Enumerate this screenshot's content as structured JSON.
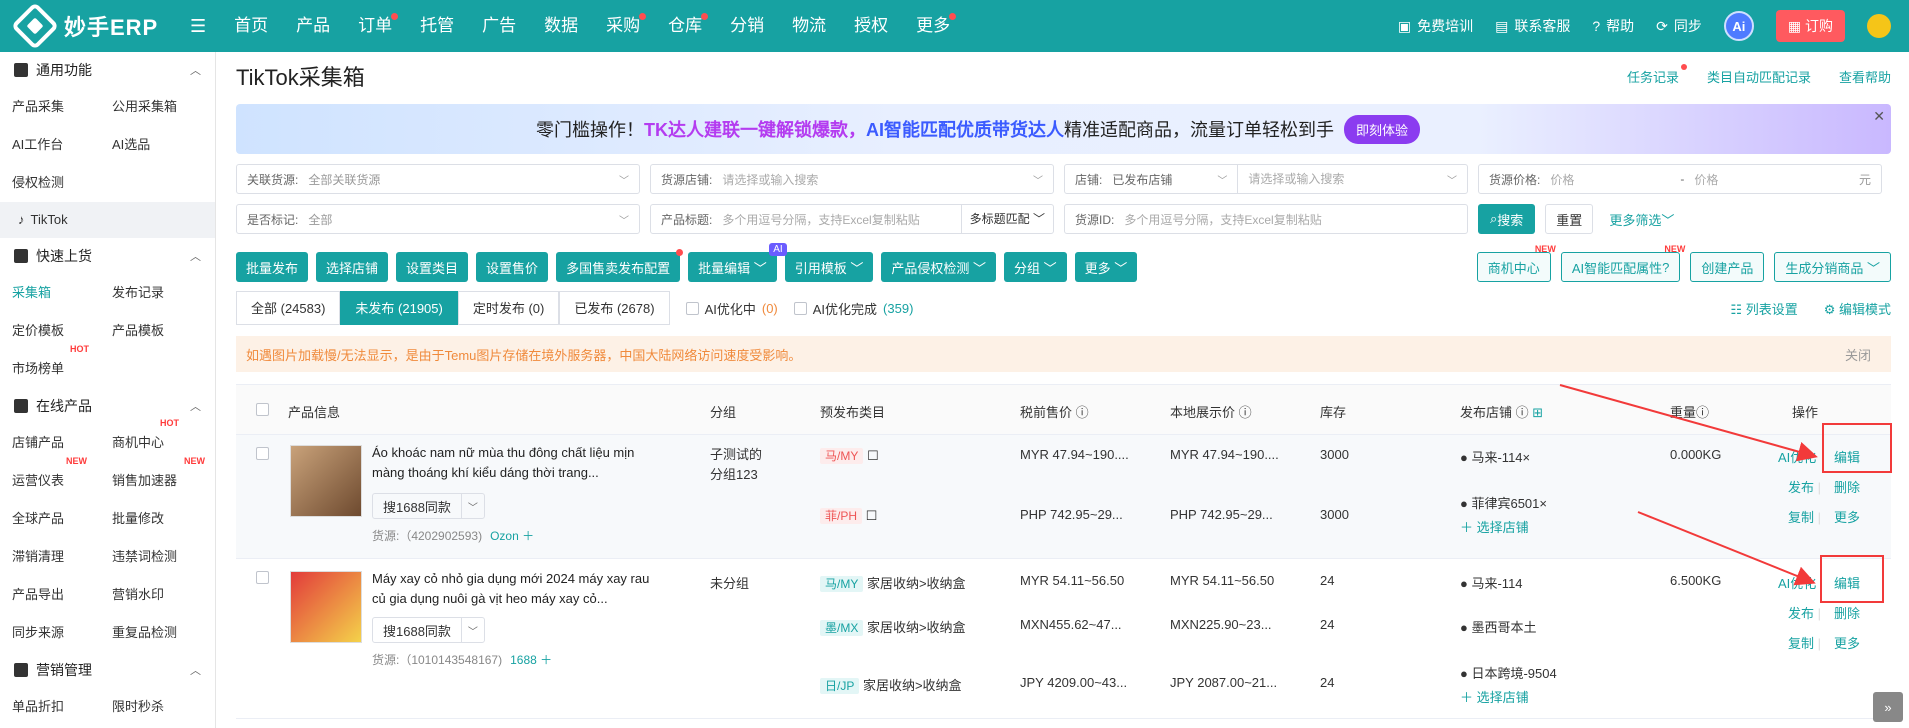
{
  "topbar": {
    "brand": "妙手ERP",
    "nav": [
      "首页",
      "产品",
      "订单",
      "托管",
      "广告",
      "数据",
      "采购",
      "仓库",
      "分销",
      "物流",
      "授权",
      "更多"
    ],
    "nav_dots": [
      false,
      false,
      true,
      false,
      false,
      false,
      true,
      true,
      false,
      false,
      false,
      true
    ],
    "right": {
      "training": "免费培训",
      "support": "联系客服",
      "help": "帮助",
      "sync": "同步",
      "ai": "Ai",
      "order": "订购"
    }
  },
  "sidebar": {
    "sec1": {
      "title": "通用功能",
      "items": [
        "产品采集",
        "公用采集箱",
        "AI工作台",
        "AI选品",
        "侵权检测"
      ]
    },
    "tiktok": "TikTok",
    "sec2": {
      "title": "快速上货",
      "items": [
        "采集箱",
        "发布记录",
        "定价模板",
        "产品模板",
        "市场榜单"
      ],
      "hot": "HOT"
    },
    "sec3": {
      "title": "在线产品",
      "items": [
        "店铺产品",
        "商机中心",
        "运营仪表",
        "销售加速器",
        "全球产品",
        "批量修改",
        "滞销清理",
        "违禁词检测",
        "产品导出",
        "营销水印",
        "同步来源",
        "重复品检测"
      ],
      "hot": "HOT",
      "new": "NEW"
    },
    "sec4": {
      "title": "营销管理",
      "items": [
        "单品折扣",
        "限时秒杀"
      ]
    }
  },
  "page": {
    "title": "TikTok采集箱",
    "links": [
      "任务记录",
      "类目自动匹配记录",
      "查看帮助"
    ]
  },
  "banner": {
    "prefix": "零门槛操作！",
    "hl1": "TK达人建联一键解锁爆款，",
    "hl2": "AI智能匹配优质带货达人",
    "suffix": " 精准适配商品，流量订单轻松到手",
    "button": "即刻体验"
  },
  "filters": {
    "relSource": {
      "label": "关联货源:",
      "value": "全部关联货源"
    },
    "sourceShop": {
      "label": "货源店铺:",
      "placeholder": "请选择或输入搜索"
    },
    "shop": {
      "label": "店铺:",
      "value": "已发布店铺",
      "placeholder": "请选择或输入搜索"
    },
    "price": {
      "label": "货源价格:",
      "min": "价格",
      "max": "价格",
      "unit": "元"
    },
    "mark": {
      "label": "是否标记:",
      "value": "全部"
    },
    "ptitle": {
      "label": "产品标题:",
      "placeholder": "多个用逗号分隔，支持Excel复制粘贴",
      "mode": "多标题匹配"
    },
    "srcId": {
      "label": "货源ID:",
      "placeholder": "多个用逗号分隔，支持Excel复制粘贴"
    },
    "search": "搜索",
    "reset": "重置",
    "more": "更多筛选"
  },
  "actions": {
    "left": [
      "批量发布",
      "选择店铺",
      "设置类目",
      "设置售价",
      "多国售卖发布配置",
      "批量编辑",
      "引用模板",
      "产品侵权检测",
      "分组",
      "更多"
    ],
    "ai": "AI",
    "right": [
      "商机中心",
      "AI智能匹配属性",
      "创建产品",
      "生成分销商品"
    ],
    "new": "NEW"
  },
  "tabs": [
    {
      "label": "全部 (24583)"
    },
    {
      "label": "未发布 (21905)"
    },
    {
      "label": "定时发布 (0)"
    },
    {
      "label": "已发布 (2678)"
    }
  ],
  "ai_opt": {
    "doing": "AI优化中",
    "doing_count": "(0)",
    "done": "AI优化完成",
    "done_count": "(359)"
  },
  "view": {
    "list": "列表设置",
    "edit": "编辑模式"
  },
  "notice": {
    "text": "如遇图片加载慢/无法显示，是由于Temu图片存储在境外服务器，中国大陆网络访问速度受影响。",
    "close": "关闭"
  },
  "table": {
    "headers": [
      "产品信息",
      "分组",
      "预发布类目",
      "税前售价",
      "本地展示价",
      "库存",
      "发布店铺",
      "重量",
      "操作"
    ],
    "rows": [
      {
        "name": "Áo khoác nam nữ mùa thu đông chất liệu mịn màng thoáng khí kiểu dáng thời trang...",
        "search": "搜1688同款",
        "source": "货源:（4202902593)",
        "source_link": "Ozon",
        "group": "子测试的分组123",
        "weight": "0.000KG",
        "subs": [
          {
            "mk": "马/MY",
            "cat": "",
            "pre": "MYR 47.94~190....",
            "local": "MYR 47.94~190....",
            "stock": "3000",
            "shop": "马来-114"
          },
          {
            "mk": "菲/PH",
            "cat": "",
            "pre": "PHP 742.95~29...",
            "local": "PHP 742.95~29...",
            "stock": "3000",
            "shop": "菲律宾6501"
          }
        ],
        "pick": "选择店铺"
      },
      {
        "name": "Máy xay cỏ nhỏ gia dụng mới 2024 máy xay rau củ gia dụng nuôi gà vịt heo máy xay cỏ...",
        "search": "搜1688同款",
        "source": "货源:（1010143548167)",
        "source_link": "1688",
        "group": "未分组",
        "weight": "6.500KG",
        "subs": [
          {
            "mk": "马/MY",
            "cat": "家居收纳>收纳盒",
            "pre": "MYR 54.11~56.50",
            "local": "MYR 54.11~56.50",
            "stock": "24",
            "shop": "马来-114"
          },
          {
            "mk": "墨/MX",
            "cat": "家居收纳>收纳盒",
            "pre": "MXN455.62~47...",
            "local": "MXN225.90~23...",
            "stock": "24",
            "shop": "墨西哥本土"
          },
          {
            "mk": "日/JP",
            "cat": "家居收纳>收纳盒",
            "pre": "JPY 4209.00~43...",
            "local": "JPY 2087.00~21...",
            "stock": "24",
            "shop": "日本跨境-9504"
          }
        ],
        "pick": "选择店铺"
      }
    ],
    "ops": {
      "ai": "AI优化",
      "edit": "编辑",
      "publish": "发布",
      "delete": "删除",
      "copy": "复制",
      "more": "更多"
    }
  }
}
